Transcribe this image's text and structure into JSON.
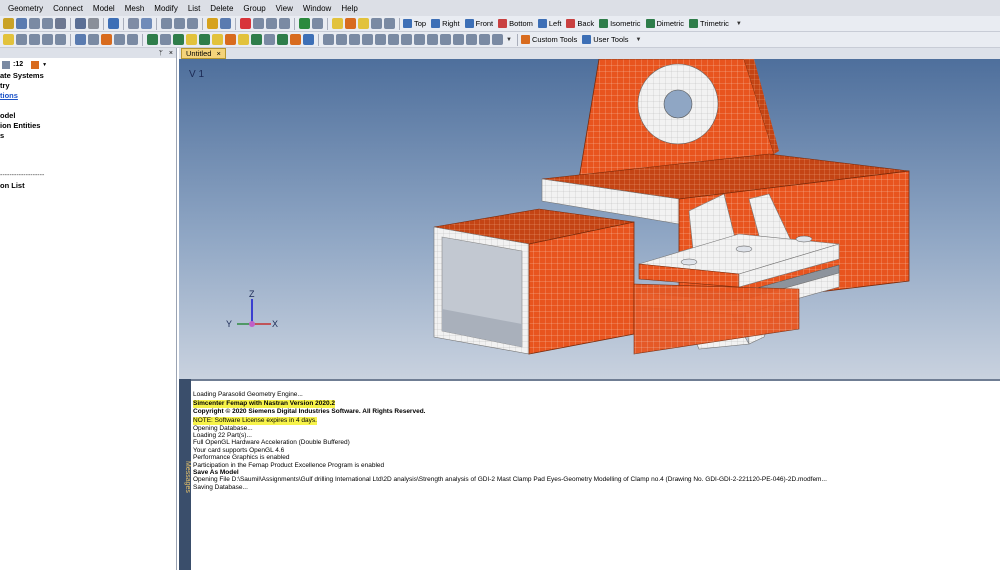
{
  "menu": [
    "Geometry",
    "Connect",
    "Model",
    "Mesh",
    "Modify",
    "List",
    "Delete",
    "Group",
    "View",
    "Window",
    "Help"
  ],
  "view_buttons": [
    "Top",
    "Right",
    "Front",
    "Bottom",
    "Left",
    "Back",
    "Isometric",
    "Dimetric",
    "Trimetric"
  ],
  "toolbar2_buttons": [
    "Custom Tools",
    "User Tools"
  ],
  "tree": {
    "count_label": ":12",
    "items": [
      "ate Systems",
      "try",
      "tions",
      "odel",
      "ion Entities",
      "s",
      "on List"
    ],
    "dashes": "-------------------"
  },
  "tab": {
    "title": "Untitled",
    "close": "×"
  },
  "viewport": {
    "label": "V 1"
  },
  "triad": {
    "z": "Z",
    "x": "X",
    "y": "Y"
  },
  "messages_title": "Messages",
  "messages": [
    "Loading Parasolid Geometry Engine...",
    "Simcenter Femap with Nastran Version 2020.2",
    "Copyright © 2020 Siemens Digital Industries Software. All Rights Reserved.",
    "NOTE: Software License expires in 4 days.",
    "Opening Database...",
    "Loading 22 Part(s)...",
    "Full OpenGL Hardware Acceleration (Double Buffered)",
    "Your card supports OpenGL 4.6",
    "Performance Graphics is enabled",
    "Participation in the Femap Product Excellence Program is enabled",
    "Save As Model",
    "Opening File D:\\Saumil\\Assignments\\Gulf drilling International Ltd\\2D analysis\\Strength analysis of GDI-2 Mast Clamp Pad Eyes-Geometry Modelling of Clamp no.4 (Drawing No. GDI-GDI-2-221120-PE-046)-2D.modfem...",
    "Saving Database..."
  ],
  "colors": {
    "mesh_orange": "#e8541e",
    "mesh_white": "#f2f2f2",
    "highlight_yellow": "#f7f34a"
  }
}
